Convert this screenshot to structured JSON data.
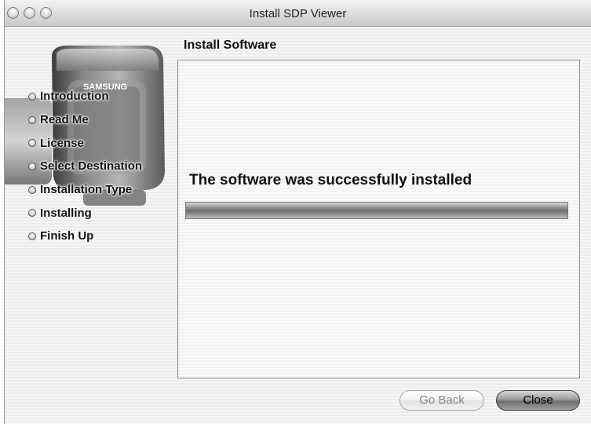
{
  "window": {
    "title": "Install SDP Viewer"
  },
  "header": {
    "section_title": "Install Software"
  },
  "sidebar": {
    "camera_brand": "SAMSUNG",
    "steps": [
      {
        "label": "Introduction"
      },
      {
        "label": "Read Me"
      },
      {
        "label": "License"
      },
      {
        "label": "Select Destination"
      },
      {
        "label": "Installation Type"
      },
      {
        "label": "Installing"
      },
      {
        "label": "Finish Up"
      }
    ]
  },
  "main": {
    "status_text": "The software was successfully installed",
    "progress_percent": 100
  },
  "buttons": {
    "go_back": "Go Back",
    "close": "Close"
  },
  "colors": {
    "title_bar": "#dcdcdc",
    "progress_fill": "#6e6e6e"
  },
  "icons": {
    "traffic_lights": [
      "close-icon",
      "minimize-icon",
      "zoom-icon"
    ],
    "step_bullet": "step-bullet-icon"
  }
}
